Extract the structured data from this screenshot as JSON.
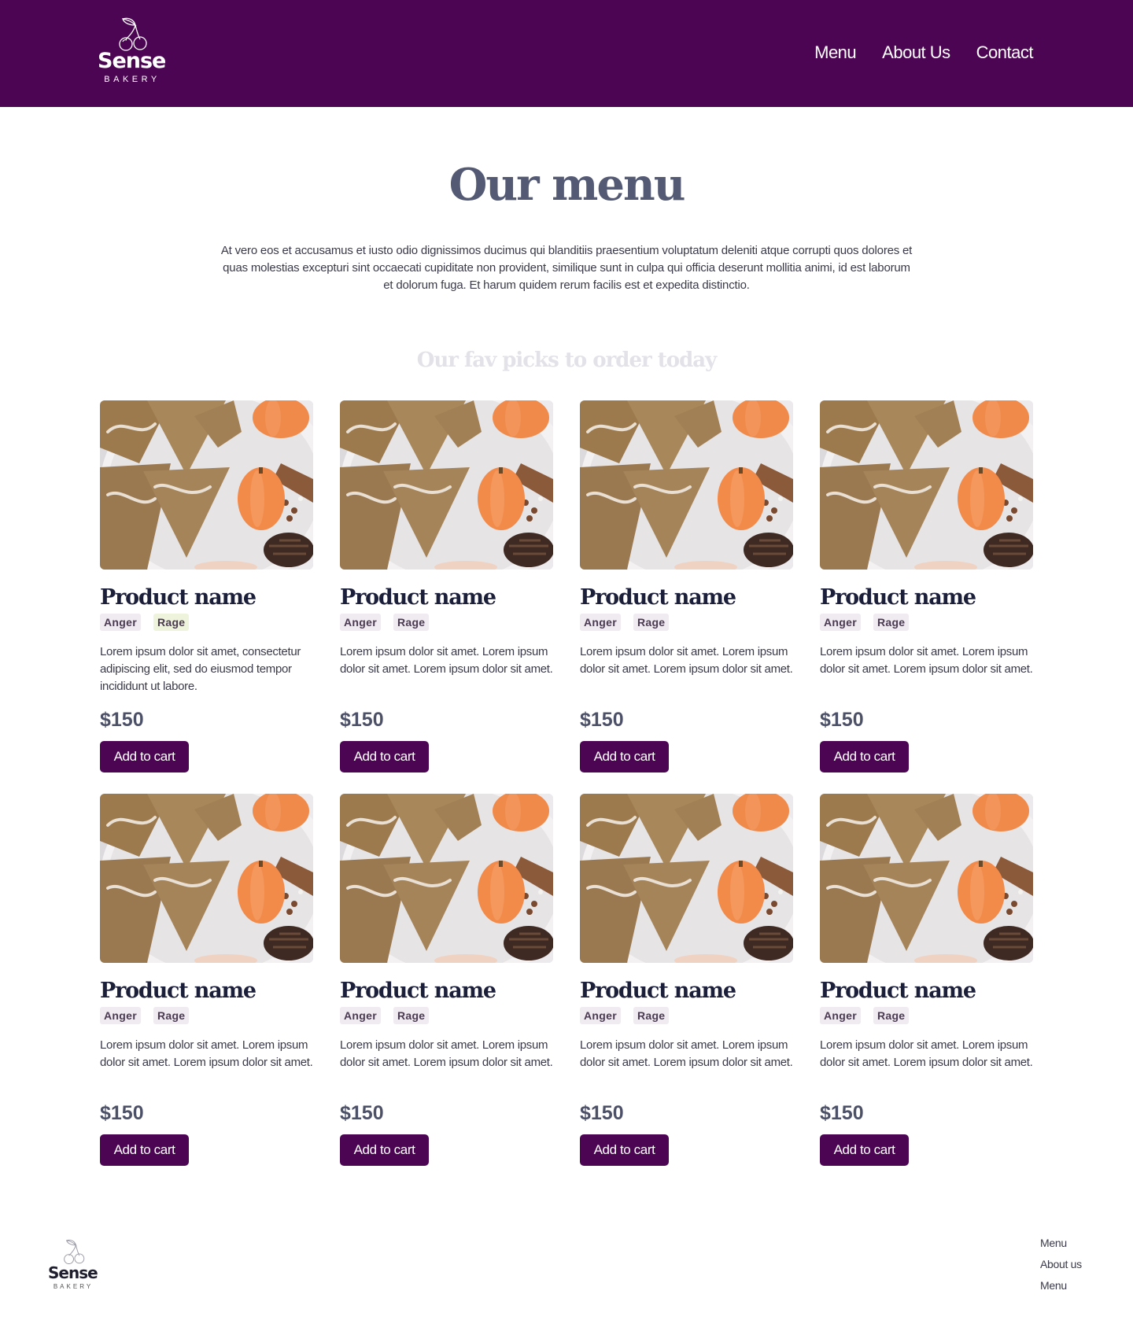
{
  "brand": {
    "name": "Sense",
    "tagline": "BAKERY"
  },
  "nav": [
    "Menu",
    "About Us",
    "Contact"
  ],
  "colors": {
    "brand": "#4c0553",
    "title": "#545a74",
    "subtitle": "#e2e2e8"
  },
  "hero": {
    "title": "Our menu",
    "intro": "At vero eos et accusamus et iusto odio dignissimos ducimus qui blanditiis praesentium voluptatum deleniti atque corrupti quos dolores et quas molestias excepturi sint occaecati cupiditate non provident, similique sunt in culpa qui officia deserunt mollitia animi, id est laborum et dolorum fuga. Et harum quidem rerum facilis est et expedita distinctio.",
    "subtitle": "Our fav picks to order today"
  },
  "products": [
    {
      "name": "Product name",
      "tags": [
        "Anger",
        "Rage"
      ],
      "desc": "Lorem ipsum dolor sit amet, consectetur adipiscing elit, sed do eiusmod tempor incididunt ut labore.",
      "price": "$150",
      "button": "Add to cart"
    },
    {
      "name": "Product name",
      "tags": [
        "Anger",
        "Rage"
      ],
      "desc": "Lorem ipsum dolor sit amet. Lorem ipsum dolor sit amet. Lorem ipsum dolor sit amet.",
      "price": "$150",
      "button": "Add to cart"
    },
    {
      "name": "Product name",
      "tags": [
        "Anger",
        "Rage"
      ],
      "desc": "Lorem ipsum dolor sit amet. Lorem ipsum dolor sit amet. Lorem ipsum dolor sit amet.",
      "price": "$150",
      "button": "Add to cart"
    },
    {
      "name": "Product name",
      "tags": [
        "Anger",
        "Rage"
      ],
      "desc": "Lorem ipsum dolor sit amet. Lorem ipsum dolor sit amet. Lorem ipsum dolor sit amet.",
      "price": "$150",
      "button": "Add to cart"
    },
    {
      "name": "Product name",
      "tags": [
        "Anger",
        "Rage"
      ],
      "desc": "Lorem ipsum dolor sit amet. Lorem ipsum dolor sit amet. Lorem ipsum dolor sit amet.",
      "price": "$150",
      "button": "Add to cart"
    },
    {
      "name": "Product name",
      "tags": [
        "Anger",
        "Rage"
      ],
      "desc": "Lorem ipsum dolor sit amet. Lorem ipsum dolor sit amet. Lorem ipsum dolor sit amet.",
      "price": "$150",
      "button": "Add to cart"
    },
    {
      "name": "Product name",
      "tags": [
        "Anger",
        "Rage"
      ],
      "desc": "Lorem ipsum dolor sit amet. Lorem ipsum dolor sit amet. Lorem ipsum dolor sit amet.",
      "price": "$150",
      "button": "Add to cart"
    },
    {
      "name": "Product name",
      "tags": [
        "Anger",
        "Rage"
      ],
      "desc": "Lorem ipsum dolor sit amet. Lorem ipsum dolor sit amet. Lorem ipsum dolor sit amet.",
      "price": "$150",
      "button": "Add to cart"
    }
  ],
  "footer": {
    "links": [
      "Menu",
      "About us",
      "Menu"
    ]
  }
}
